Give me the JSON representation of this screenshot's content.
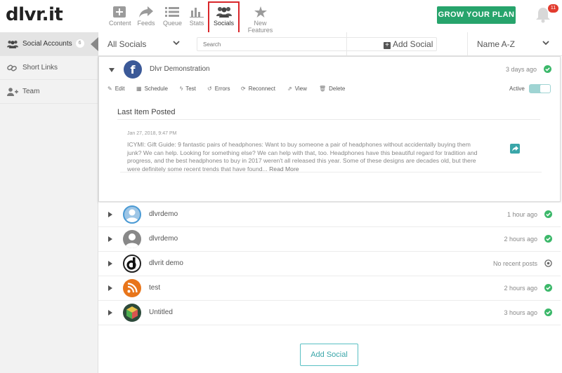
{
  "app": {
    "logo": "dlvr.it"
  },
  "nav": {
    "items": [
      {
        "label": "Content",
        "icon": "plus-square-icon"
      },
      {
        "label": "Feeds",
        "icon": "share-arrow-icon"
      },
      {
        "label": "Queue",
        "icon": "list-icon"
      },
      {
        "label": "Stats",
        "icon": "bar-chart-icon"
      },
      {
        "label": "Socials",
        "icon": "users-icon",
        "active": true
      },
      {
        "label": "New Features",
        "icon": "star-icon"
      }
    ],
    "grow_button": "GROW YOUR PLAN",
    "notifications_count": "11"
  },
  "sidebar": {
    "items": [
      {
        "label": "Social Accounts",
        "count": "6",
        "icon": "users-icon",
        "active": true
      },
      {
        "label": "Short Links",
        "icon": "link-icon"
      },
      {
        "label": "Team",
        "icon": "add-user-icon"
      }
    ]
  },
  "filters": {
    "socials_filter": "All Socials",
    "search_placeholder": "Search",
    "add_social": "Add Social",
    "sort": "Name A-Z"
  },
  "expanded": {
    "name": "Dlvr Demonstration",
    "time": "3 days ago",
    "network": "facebook",
    "actions": [
      "Edit",
      "Schedule",
      "Test",
      "Errors",
      "Reconnect",
      "View",
      "Delete"
    ],
    "active_label": "Active",
    "active": true,
    "last_item_title": "Last Item Posted",
    "post_date": "Jan 27, 2018, 9:47 PM",
    "post_text": "ICYMI: Gift Guide: 9 fantastic pairs of headphones:  Want to buy someone a pair of headphones without accidentally buying them junk? We can help. Looking for something else? We can help with that, too. Headphones have this beautiful regard for tradition and progress, and the best headphones to buy in 2017 weren't all released this year. Some of these designs are decades old, but there were definitely some recent trends that have found...",
    "read_more": "Read More"
  },
  "accounts": [
    {
      "name": "dlvrdemo",
      "time": "1 hour ago",
      "avatar": "twitter-user",
      "status": "ok"
    },
    {
      "name": "dlvrdemo",
      "time": "2 hours ago",
      "avatar": "generic-user",
      "status": "ok"
    },
    {
      "name": "dlvrit demo",
      "time": "No recent posts",
      "avatar": "dlvrit-logo",
      "status": "idle"
    },
    {
      "name": "test",
      "time": "2 hours ago",
      "avatar": "rss",
      "status": "ok"
    },
    {
      "name": "Untitled",
      "time": "3 hours ago",
      "avatar": "cube",
      "status": "ok"
    }
  ],
  "footer": {
    "add_social_button": "Add Social"
  },
  "colors": {
    "accent_green": "#27a46c",
    "facebook": "#3b5998",
    "teal": "#3aa6a9",
    "status_ok": "#3cb86a"
  }
}
